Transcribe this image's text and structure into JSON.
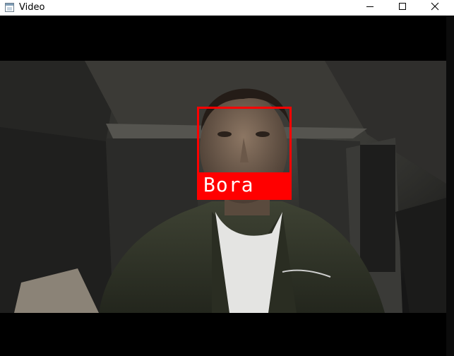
{
  "window": {
    "title": "Video",
    "icon": "app-window-icon",
    "controls": {
      "minimize_icon": "minimize-icon",
      "maximize_icon": "maximize-icon",
      "close_icon": "close-icon"
    }
  },
  "video": {
    "detection": {
      "label": "Bora",
      "box_color": "#ff0000",
      "label_color": "#ffffff"
    }
  }
}
